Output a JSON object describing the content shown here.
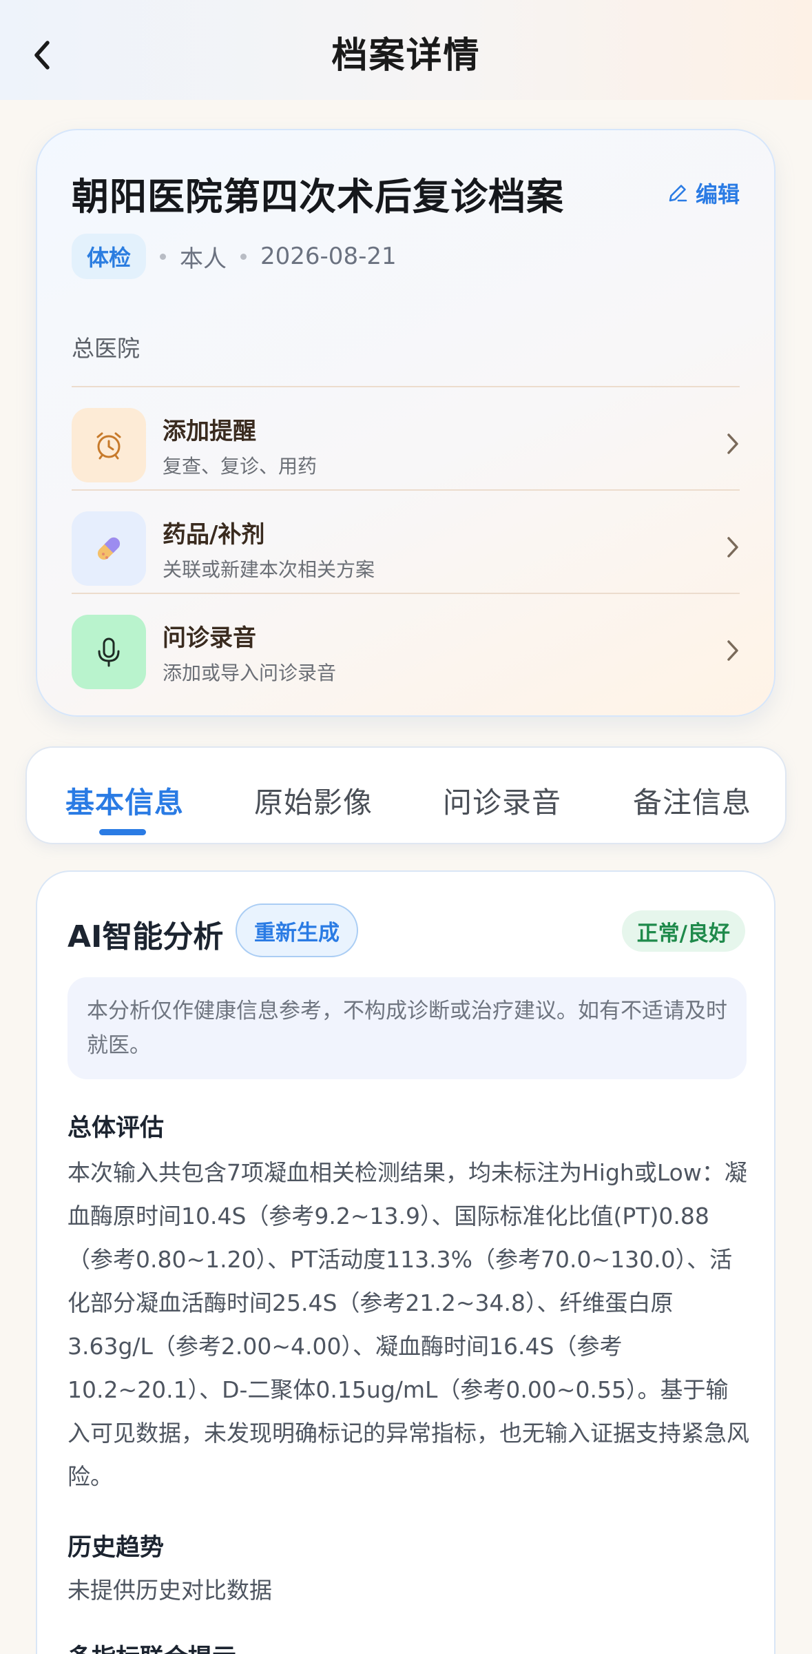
{
  "header": {
    "title": "档案详情"
  },
  "record": {
    "title": "朝阳医院第四次术后复诊档案",
    "edit_label": "编辑",
    "tag": "体检",
    "person": "本人",
    "date": "2026-08-21",
    "hospital": "总医院",
    "actions": [
      {
        "title": "添加提醒",
        "subtitle": "复查、复诊、用药",
        "icon": "alarm-clock-icon",
        "bg": "#fdebd6"
      },
      {
        "title": "药品/补剂",
        "subtitle": "关联或新建本次相关方案",
        "icon": "pill-icon",
        "bg": "#e6eefd"
      },
      {
        "title": "问诊录音",
        "subtitle": "添加或导入问诊录音",
        "icon": "microphone-icon",
        "bg": "#b9f3cd"
      }
    ]
  },
  "tabs": [
    {
      "label": "基本信息",
      "active": true
    },
    {
      "label": "原始影像",
      "active": false
    },
    {
      "label": "问诊录音",
      "active": false
    },
    {
      "label": "备注信息",
      "active": false
    }
  ],
  "ai": {
    "title": "AI智能分析",
    "regenerate_label": "重新生成",
    "status": "正常/良好",
    "disclaimer": "本分析仅作健康信息参考，不构成诊断或治疗建议。如有不适请及时就医。",
    "sections": [
      {
        "title": "总体评估",
        "body": "本次输入共包含7项凝血相关检测结果，均未标注为High或Low：凝血酶原时间10.4S（参考9.2~13.9）、国际标准化比值(PT)0.88（参考0.80~1.20）、PT活动度113.3%（参考70.0~130.0）、活化部分凝血活酶时间25.4S（参考21.2~34.8）、纤维蛋白原3.63g/L（参考2.00~4.00）、凝血酶时间16.4S（参考10.2~20.1）、D-二聚体0.15ug/mL（参考0.00~0.55）。基于输入可见数据，未发现明确标记的异常指标，也无输入证据支持紧急风险。"
      },
      {
        "title": "历史趋势",
        "body": "未提供历史对比数据"
      },
      {
        "title": "多指标联合提示",
        "body": ""
      }
    ]
  },
  "colors": {
    "accent": "#2a7be4",
    "status_green": "#1f8a4b",
    "page_bg": "#faf7f2"
  }
}
